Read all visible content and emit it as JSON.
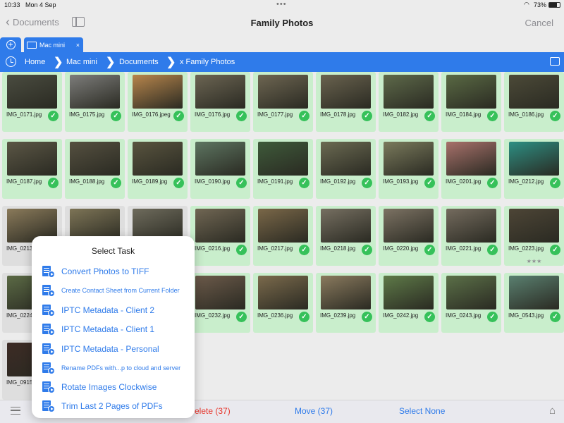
{
  "status": {
    "time": "10:33",
    "date": "Mon 4 Sep",
    "battery": "73%",
    "battery_level": 0.73
  },
  "nav": {
    "back_label": "Documents",
    "title": "Family Photos",
    "cancel_label": "Cancel"
  },
  "tab": {
    "label": "Mac mini",
    "close": "×"
  },
  "breadcrumb": {
    "items": [
      "Home",
      "Mac mini",
      "Documents",
      "x Family Photos"
    ]
  },
  "photos": [
    {
      "name": "IMG_0171.jpg",
      "checked": true,
      "color": "#4a4c40"
    },
    {
      "name": "IMG_0175.jpg",
      "checked": true,
      "color": "#7d7d7b"
    },
    {
      "name": "IMG_0176.jpeg",
      "checked": true,
      "color": "#b8864c"
    },
    {
      "name": "IMG_0176.jpg",
      "checked": true,
      "color": "#6c6553"
    },
    {
      "name": "IMG_0177.jpg",
      "checked": true,
      "color": "#6e6652"
    },
    {
      "name": "IMG_0178.jpg",
      "checked": true,
      "color": "#6a634f"
    },
    {
      "name": "IMG_0182.jpg",
      "checked": true,
      "color": "#5e6a4a"
    },
    {
      "name": "IMG_0184.jpg",
      "checked": true,
      "color": "#5a6a44"
    },
    {
      "name": "IMG_0186.jpg",
      "checked": true,
      "color": "#4c4a38"
    },
    {
      "name": "IMG_0187.jpg",
      "checked": true,
      "color": "#5b5645"
    },
    {
      "name": "IMG_0188.jpg",
      "checked": true,
      "color": "#555040"
    },
    {
      "name": "IMG_0189.jpg",
      "checked": true,
      "color": "#59543f"
    },
    {
      "name": "IMG_0190.jpg",
      "checked": true,
      "color": "#5d7561"
    },
    {
      "name": "IMG_0191.jpg",
      "checked": true,
      "color": "#3e5a3a"
    },
    {
      "name": "IMG_0192.jpg",
      "checked": true,
      "color": "#6b6a52"
    },
    {
      "name": "IMG_0193.jpg",
      "checked": true,
      "color": "#7a7a5c"
    },
    {
      "name": "IMG_0201.jpg",
      "checked": true,
      "color": "#a8716b"
    },
    {
      "name": "IMG_0212.jpg",
      "checked": true,
      "color": "#2d8f83"
    },
    {
      "name": "IMG_0213.jpg",
      "checked": false,
      "color": "#8a7a5a"
    },
    {
      "name": "",
      "checked": false,
      "color": "#7d7456"
    },
    {
      "name": "",
      "checked": false,
      "color": "#6e6b5c"
    },
    {
      "name": "IMG_0216.jpg",
      "checked": true,
      "color": "#706653"
    },
    {
      "name": "IMG_0217.jpg",
      "checked": true,
      "color": "#7a6748"
    },
    {
      "name": "IMG_0218.jpg",
      "checked": true,
      "color": "#766f61"
    },
    {
      "name": "IMG_0220.jpg",
      "checked": true,
      "color": "#7c7263"
    },
    {
      "name": "IMG_0221.jpg",
      "checked": true,
      "color": "#746b5e"
    },
    {
      "name": "IMG_0223.jpg",
      "checked": true,
      "color": "#4d4536",
      "stars": "★★★"
    },
    {
      "name": "IMG_0224.jpg",
      "checked": false,
      "color": "#5b6a45"
    },
    {
      "name": "",
      "checked": false,
      "color": "#777"
    },
    {
      "name": "",
      "checked": false,
      "color": "#777"
    },
    {
      "name": "IMG_0232.jpg",
      "checked": true,
      "color": "#6c5a4a"
    },
    {
      "name": "IMG_0236.jpg",
      "checked": true,
      "color": "#7b6a4c"
    },
    {
      "name": "IMG_0239.jpg",
      "checked": true,
      "color": "#8a7a5e"
    },
    {
      "name": "IMG_0242.jpg",
      "checked": true,
      "color": "#5e7a48"
    },
    {
      "name": "IMG_0243.jpg",
      "checked": true,
      "color": "#5b7048"
    },
    {
      "name": "IMG_0543.jpg",
      "checked": true,
      "color": "#5a8070"
    },
    {
      "name": "IMG_0915.jpg",
      "checked": false,
      "color": "#3d2b25"
    }
  ],
  "popover": {
    "title": "Select Task",
    "tasks": [
      {
        "label": "Convert Photos to TIFF",
        "size": "big"
      },
      {
        "label": "Create Contact Sheet from Current Folder",
        "size": "small"
      },
      {
        "label": "IPTC Metadata - Client 2",
        "size": "big"
      },
      {
        "label": "IPTC Metadata - Client 1",
        "size": "big"
      },
      {
        "label": "IPTC Metadata - Personal",
        "size": "big"
      },
      {
        "label": "Rename PDFs with...p to cloud and server",
        "size": "small"
      },
      {
        "label": "Rotate Images Clockwise",
        "size": "big"
      },
      {
        "label": "Trim Last 2 Pages of PDFs",
        "size": "big"
      }
    ]
  },
  "bottom": {
    "delete_label": "elete (37)",
    "move_label": "Move (37)",
    "select_none_label": "Select None"
  }
}
